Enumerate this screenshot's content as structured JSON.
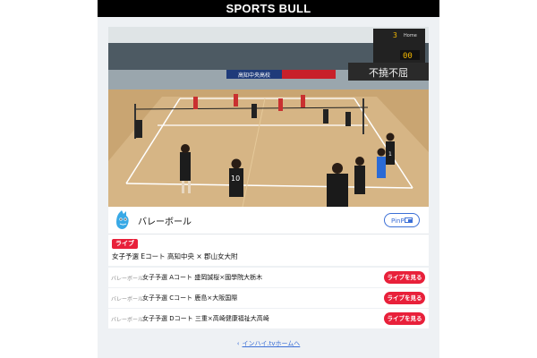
{
  "header": {
    "brand": "SPORTS BULL"
  },
  "video": {
    "banner_left": "高知中央高校",
    "banner_mid": "",
    "banner_right": "不撓不屈",
    "score_home": "3",
    "score_away": "00",
    "scoreboard_label": "Home",
    "jersey_1": "10",
    "jersey_2": "1"
  },
  "sport_card": {
    "title": "バレーボール",
    "pip_label": "PinP"
  },
  "live": {
    "badge": "ライブ",
    "title": "女子予選 Eコート 高知中央 × 郡山女大附"
  },
  "matches": [
    {
      "sport": "バレーボール",
      "title": "女子予選 Aコート 盛岡誠桜×國學院大栃木",
      "button": "ライブを見る"
    },
    {
      "sport": "バレーボール",
      "title": "女子予選 Cコート 鹿島×大阪国際",
      "button": "ライブを見る"
    },
    {
      "sport": "バレーボール",
      "title": "女子予選 Dコート 三重×高崎健康福祉大高崎",
      "button": "ライブを見る"
    }
  ],
  "footer": {
    "home_link": "インハイ.tvホームへ"
  },
  "colors": {
    "accent_red": "#e8203a",
    "link_blue": "#3b6fd6",
    "header_black": "#000000"
  }
}
